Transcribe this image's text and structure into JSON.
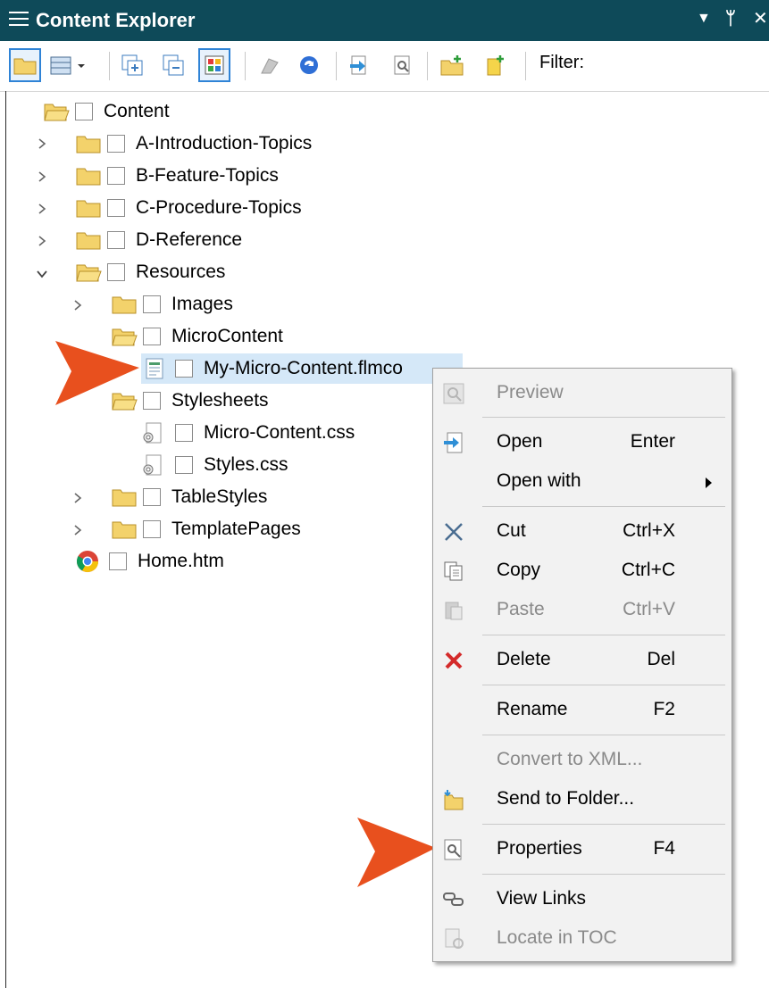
{
  "panel": {
    "title": "Content Explorer",
    "pin_glyph": "ᛘ",
    "close_glyph": "✕",
    "dropdown_glyph": "▼"
  },
  "toolbar": {
    "filter_label": "Filter:",
    "buttons": [
      "folder-toggle-icon",
      "grid-view-icon",
      "expand-all-icon",
      "collapse-all-icon",
      "color-grid-icon",
      "publish-icon",
      "refresh-icon",
      "open-icon",
      "properties-icon",
      "new-folder-icon",
      "new-item-icon"
    ]
  },
  "tree": {
    "root": "Content",
    "items": [
      {
        "label": "A-Introduction-Topics",
        "type": "folder",
        "expanded": false
      },
      {
        "label": "B-Feature-Topics",
        "type": "folder",
        "expanded": false
      },
      {
        "label": "C-Procedure-Topics",
        "type": "folder",
        "expanded": false
      },
      {
        "label": "D-Reference",
        "type": "folder",
        "expanded": false
      },
      {
        "label": "Resources",
        "type": "folder",
        "expanded": true
      },
      {
        "label": "Images",
        "type": "folder",
        "expanded": false
      },
      {
        "label": "MicroContent",
        "type": "folder",
        "expanded": true
      },
      {
        "label": "My-Micro-Content.flmco",
        "type": "file",
        "selected": true
      },
      {
        "label": "Stylesheets",
        "type": "folder",
        "expanded": true
      },
      {
        "label": "Micro-Content.css",
        "type": "css"
      },
      {
        "label": "Styles.css",
        "type": "css"
      },
      {
        "label": "TableStyles",
        "type": "folder",
        "expanded": false
      },
      {
        "label": "TemplatePages",
        "type": "folder",
        "expanded": false
      },
      {
        "label": "Home.htm",
        "type": "html"
      }
    ]
  },
  "context_menu": {
    "items": [
      {
        "label": "Preview",
        "shortcut": "",
        "enabled": false,
        "icon": "preview-icon"
      },
      {
        "label": "Open",
        "shortcut": "Enter",
        "enabled": true,
        "icon": "open-document-icon"
      },
      {
        "label": "Open with",
        "shortcut": "",
        "enabled": true,
        "icon": "",
        "submenu": true
      },
      {
        "label": "Cut",
        "shortcut": "Ctrl+X",
        "enabled": true,
        "icon": "scissors-icon"
      },
      {
        "label": "Copy",
        "shortcut": "Ctrl+C",
        "enabled": true,
        "icon": "copy-icon"
      },
      {
        "label": "Paste",
        "shortcut": "Ctrl+V",
        "enabled": false,
        "icon": "paste-icon"
      },
      {
        "label": "Delete",
        "shortcut": "Del",
        "enabled": true,
        "icon": "delete-x-icon"
      },
      {
        "label": "Rename",
        "shortcut": "F2",
        "enabled": true,
        "icon": ""
      },
      {
        "label": "Convert to XML...",
        "shortcut": "",
        "enabled": false,
        "icon": ""
      },
      {
        "label": "Send to Folder...",
        "shortcut": "",
        "enabled": true,
        "icon": "send-to-folder-icon"
      },
      {
        "label": "Properties",
        "shortcut": "F4",
        "enabled": true,
        "icon": "properties-icon"
      },
      {
        "label": "View Links",
        "shortcut": "",
        "enabled": true,
        "icon": "links-icon"
      },
      {
        "label": "Locate in TOC",
        "shortcut": "",
        "enabled": false,
        "icon": "locate-toc-icon"
      }
    ]
  },
  "colors": {
    "title_bar": "#0e4a59",
    "selection": "#d5e8f8",
    "callout_arrow": "#e8501e",
    "folder": "#f3d26b"
  }
}
